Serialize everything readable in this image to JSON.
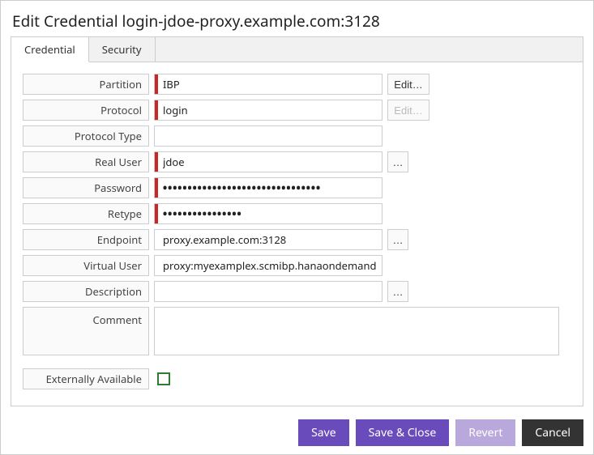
{
  "title": "Edit Credential login-jdoe-proxy.example.com:3128",
  "tabs": {
    "credential": "Credential",
    "security": "Security"
  },
  "labels": {
    "partition": "Partition",
    "protocol": "Protocol",
    "protocol_type": "Protocol Type",
    "real_user": "Real User",
    "password": "Password",
    "retype": "Retype",
    "endpoint": "Endpoint",
    "virtual_user": "Virtual User",
    "description": "Description",
    "comment": "Comment",
    "externally_available": "Externally Available"
  },
  "values": {
    "partition": "IBP",
    "protocol": "login",
    "protocol_type": "",
    "real_user": "jdoe",
    "password": "••••••••••••••••••••••••••••••••",
    "retype": "••••••••••••••••",
    "endpoint": "proxy.example.com:3128",
    "virtual_user": "proxy:myexamplex.scmibp.hanaondemand.com",
    "description": "",
    "comment": "",
    "externally_available": false
  },
  "buttons": {
    "edit": "Edit…",
    "ellipsis": "…",
    "save": "Save",
    "save_close": "Save & Close",
    "revert": "Revert",
    "cancel": "Cancel"
  }
}
